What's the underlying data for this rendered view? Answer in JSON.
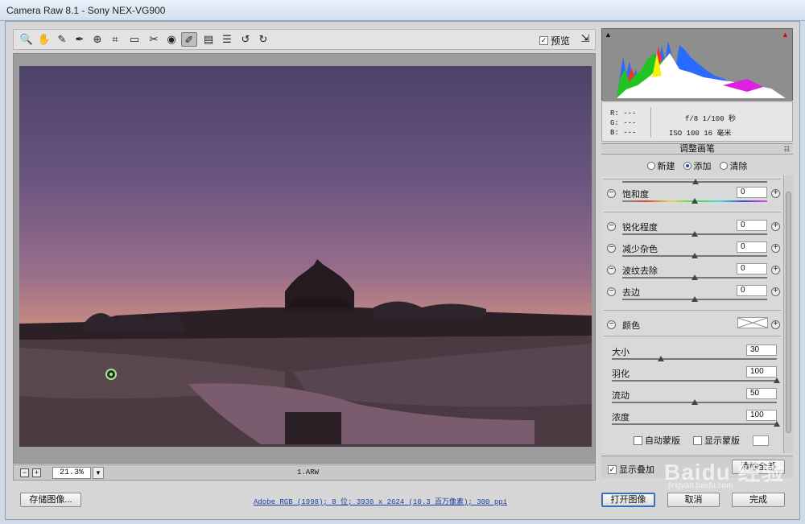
{
  "window": {
    "title": "Camera Raw 8.1 -  Sony NEX-VG900"
  },
  "toolbar": {
    "tools": [
      {
        "name": "zoom-tool-icon",
        "glyph": "🔍"
      },
      {
        "name": "hand-tool-icon",
        "glyph": "✋"
      },
      {
        "name": "white-balance-icon",
        "glyph": "✎"
      },
      {
        "name": "color-sampler-icon",
        "glyph": "✒"
      },
      {
        "name": "target-adjust-icon",
        "glyph": "⊕"
      },
      {
        "name": "crop-tool-icon",
        "glyph": "⌗"
      },
      {
        "name": "straighten-tool-icon",
        "glyph": "▭"
      },
      {
        "name": "spot-removal-icon",
        "glyph": "✂"
      },
      {
        "name": "red-eye-icon",
        "glyph": "◉"
      },
      {
        "name": "adjustment-brush-icon",
        "glyph": "✐"
      },
      {
        "name": "graduated-filter-icon",
        "glyph": "▤"
      },
      {
        "name": "radial-filter-icon",
        "glyph": "☰"
      },
      {
        "name": "rotate-left-icon",
        "glyph": "↺"
      },
      {
        "name": "rotate-right-icon",
        "glyph": "↻"
      }
    ],
    "preview_label": "预览",
    "preview_checked": "✓"
  },
  "status": {
    "zoom": "21.3%",
    "filename": "1.ARW",
    "zoom_out": "−",
    "zoom_in": "+",
    "dropdown": "▼"
  },
  "info": {
    "r": "R:  ---",
    "g": "G:  ---",
    "b": "B:  ---",
    "exif_line1": "f/8  1/100 秒",
    "exif_line2": "ISO 100  16 毫米"
  },
  "panel": {
    "title": "调整画笔",
    "menu": "☷",
    "modes": [
      {
        "label": "新建",
        "selected": false
      },
      {
        "label": "添加",
        "selected": true
      },
      {
        "label": "清除",
        "selected": false
      }
    ],
    "sliders": [
      {
        "label": "饱和度",
        "value": "0"
      },
      {
        "label": "锐化程度",
        "value": "0"
      },
      {
        "label": "减少杂色",
        "value": "0"
      },
      {
        "label": "波纹去除",
        "value": "0"
      },
      {
        "label": "去边",
        "value": "0"
      }
    ],
    "color_label": "颜色",
    "brush": [
      {
        "label": "大小",
        "value": "30"
      },
      {
        "label": "羽化",
        "value": "100"
      },
      {
        "label": "流动",
        "value": "50"
      },
      {
        "label": "浓度",
        "value": "100"
      }
    ],
    "auto_mask": "自动蒙版",
    "show_mask": "显示蒙版",
    "show_overlay": "显示叠加",
    "clear_all": "清除全部"
  },
  "bottom": {
    "save": "存储图像...",
    "workflow": "Adobe RGB (1998); 8 位; 3936 x 2624 (10.3 百万像素); 300 ppi",
    "open": "打开图像",
    "cancel": "取消",
    "done": "完成"
  },
  "watermark": {
    "text": "Baidu 经验",
    "sub": "jingyan.baidu.com"
  }
}
